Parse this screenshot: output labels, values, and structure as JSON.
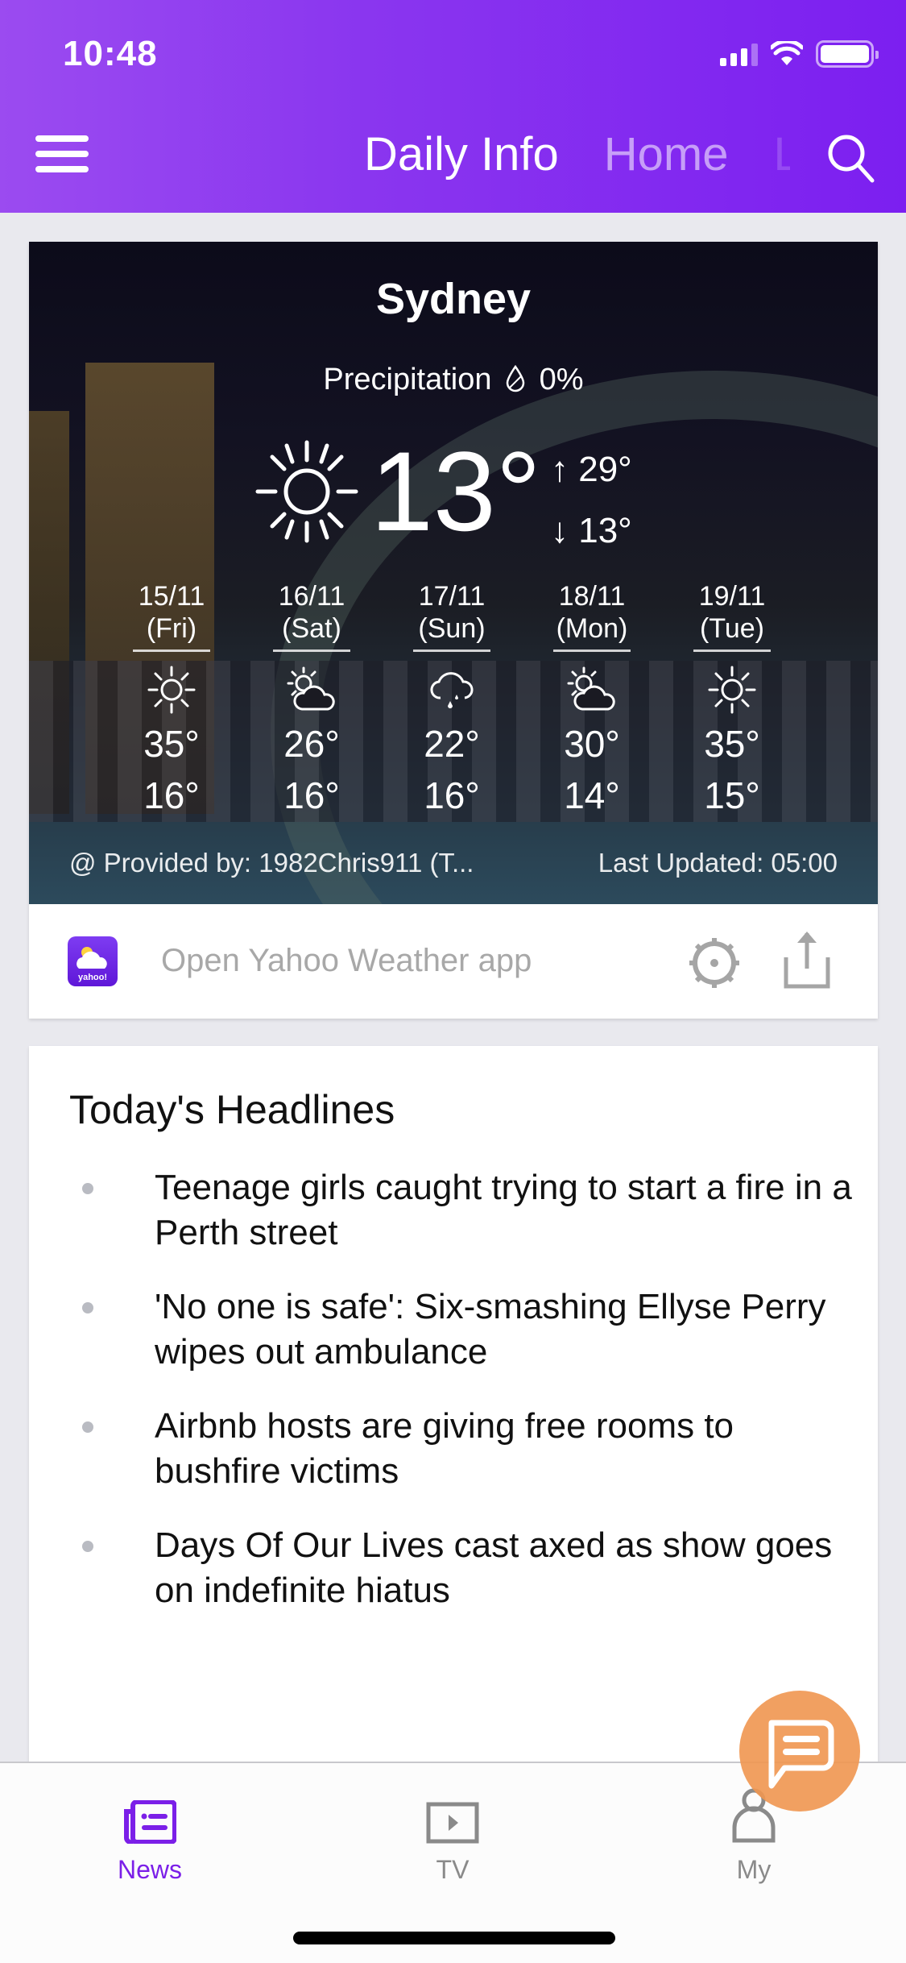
{
  "status_bar": {
    "time": "10:48"
  },
  "header": {
    "menu_icon": "hamburger-icon",
    "tabs": [
      {
        "label": "Daily Info",
        "active": true
      },
      {
        "label": "Home",
        "active": false
      },
      {
        "label": "L",
        "active": false
      }
    ],
    "search_icon": "search-icon"
  },
  "weather": {
    "city": "Sydney",
    "precipitation_label": "Precipitation",
    "precipitation_value": "0%",
    "current_temp": "13°",
    "condition_icon": "sun-icon",
    "high": "29°",
    "low": "13°",
    "forecast": [
      {
        "date": "15/11",
        "day": "(Fri)",
        "icon": "sun-icon",
        "high": "35°",
        "low": "16°"
      },
      {
        "date": "16/11",
        "day": "(Sat)",
        "icon": "partly-cloudy-icon",
        "high": "26°",
        "low": "16°"
      },
      {
        "date": "17/11",
        "day": "(Sun)",
        "icon": "rain-cloud-icon",
        "high": "22°",
        "low": "16°"
      },
      {
        "date": "18/11",
        "day": "(Mon)",
        "icon": "partly-cloudy-icon",
        "high": "30°",
        "low": "14°"
      },
      {
        "date": "19/11",
        "day": "(Tue)",
        "icon": "sun-icon",
        "high": "35°",
        "low": "15°"
      }
    ],
    "provided_by": "@ Provided by: 1982Chris911 (T...",
    "last_updated": "Last Updated: 05:00",
    "open_app_label": "Open Yahoo Weather app",
    "yahoo_badge": "yahoo!"
  },
  "headlines": {
    "title": "Today's Headlines",
    "items": [
      "Teenage girls caught trying to start a fire in a Perth street",
      "'No one is safe': Six-smashing Ellyse Perry wipes out ambulance",
      "Airbnb hosts are giving free rooms to bushfire victims",
      "Days Of Our Lives cast axed as show goes on indefinite hiatus"
    ]
  },
  "tabbar": {
    "items": [
      {
        "label": "News",
        "icon": "newspaper-icon",
        "active": true
      },
      {
        "label": "TV",
        "icon": "tv-play-icon",
        "active": false
      },
      {
        "label": "My",
        "icon": "person-icon",
        "active": false
      }
    ]
  },
  "colors": {
    "brand_purple": "#7b1fe8",
    "chat_fab": "#f0964f",
    "inactive_gray": "#8a8a8a"
  }
}
